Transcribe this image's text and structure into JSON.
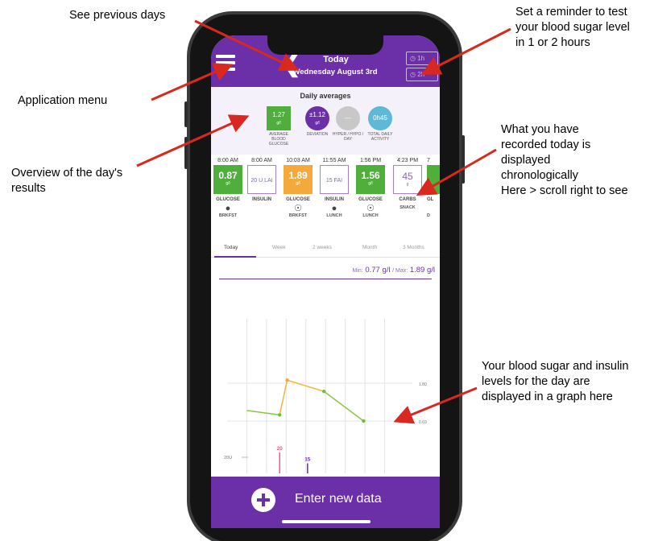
{
  "annotations": {
    "previous_days": "See previous days",
    "reminder": [
      "Set a reminder to test",
      "your blood sugar level",
      "in 1 or 2 hours"
    ],
    "app_menu": "Application menu",
    "overview": [
      "Overview of the day's",
      "results"
    ],
    "recorded": [
      "What you have",
      "recorded today is",
      "displayed",
      "chronologically",
      "Here > scroll right to see"
    ],
    "graph": [
      "Your blood sugar and insulin",
      "levels for the day are",
      "displayed in a graph here"
    ]
  },
  "header": {
    "title": "Today",
    "date": "Wednesday August 3rd",
    "reminders": [
      "1h",
      "2h"
    ]
  },
  "daily_averages": {
    "title": "Daily averages",
    "items": [
      {
        "value": "1.27",
        "unit": "g/l",
        "label": "AVERAGE BLOOD GLUCOSE",
        "color": "#4fae3c"
      },
      {
        "value": "±1.12",
        "unit": "g/l",
        "label": "DEVIATION",
        "color": "#6b2fa8"
      },
      {
        "value": "---",
        "unit": "",
        "label": "HYPER / HYPO / DAY",
        "color": "#c8c8c8"
      },
      {
        "value": "0h45",
        "unit": "",
        "label": "TOTAL DAILY ACTIVITY",
        "color": "#5fb8d6"
      }
    ]
  },
  "timeline": [
    {
      "time": "8:00 AM",
      "value": "0.87",
      "unit": "g/l",
      "category": "GLUCOSE",
      "meal": "BRKFST",
      "icon": "apple-icon",
      "style": "green"
    },
    {
      "time": "8:00 AM",
      "value": "20 U LAI",
      "unit": "",
      "category": "INSULIN",
      "meal": "",
      "icon": "",
      "style": "outline"
    },
    {
      "time": "10:03 AM",
      "value": "1.89",
      "unit": "g/l",
      "category": "GLUCOSE",
      "meal": "BRKFST",
      "icon": "drink-icon",
      "style": "orange"
    },
    {
      "time": "11:55 AM",
      "value": "15 FAI",
      "unit": "",
      "category": "INSULIN",
      "meal": "LUNCH",
      "icon": "apple-icon",
      "style": "outline"
    },
    {
      "time": "1:56 PM",
      "value": "1.56",
      "unit": "g/l",
      "category": "GLUCOSE",
      "meal": "LUNCH",
      "icon": "drink-icon",
      "style": "green"
    },
    {
      "time": "4:23 PM",
      "value": "45",
      "unit": "g",
      "category": "CARBS",
      "meal": "SNACK",
      "icon": "",
      "style": "outline"
    },
    {
      "time": "7",
      "value": "",
      "unit": "",
      "category": "GL",
      "meal": "D",
      "icon": "",
      "style": "green"
    }
  ],
  "tabs": [
    "Today",
    "Week",
    "2 weeks",
    "Month",
    "3 Months"
  ],
  "range": {
    "min_label": "Min:",
    "min": "0.77 g/l",
    "max_label": "Max:",
    "max": "1.89 g/l"
  },
  "chart_data": {
    "type": "line",
    "glucose_axis_labels": [
      "1.80",
      "0.69"
    ],
    "insulin_axis_label": "20U",
    "glucose": [
      {
        "x": "8:00 AM",
        "y": 1.0
      },
      {
        "x": "9:40 AM",
        "y": 0.87
      },
      {
        "x": "10:03 AM",
        "y": 1.89
      },
      {
        "x": "11:55 AM",
        "y": 1.56
      },
      {
        "x": "1:56 PM",
        "y": 0.69
      }
    ],
    "insulin": [
      {
        "x": "9:40 AM",
        "value": 20,
        "label": "20",
        "color": "#e0607e"
      },
      {
        "x": "11:05 AM",
        "value": 15,
        "label": "15",
        "color": "#6b2fa8"
      }
    ]
  },
  "bottom": {
    "enter_label": "Enter new data"
  }
}
